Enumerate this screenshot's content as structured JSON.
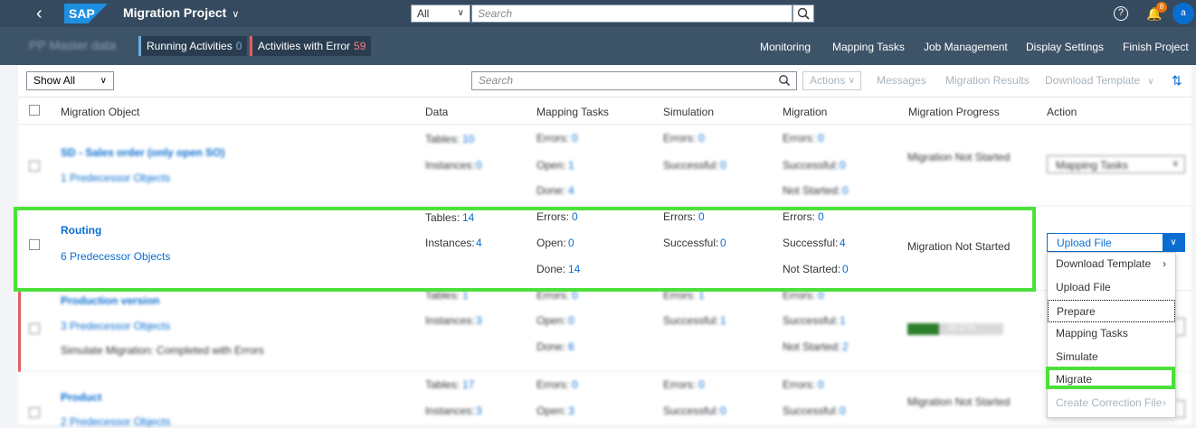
{
  "shell": {
    "logo": "SAP",
    "app_title": "Migration Project",
    "scope": "All",
    "search_placeholder": "Search",
    "notification_count": "8",
    "avatar_initial": "a"
  },
  "subheader": {
    "title": "PP Master data",
    "running_label": "Running Activities",
    "running_count": "0",
    "error_label": "Activities with Error",
    "error_count": "59",
    "nav": [
      "Monitoring",
      "Mapping Tasks",
      "Job Management",
      "Display Settings",
      "Finish Project"
    ]
  },
  "toolbar": {
    "filter": "Show All",
    "search_placeholder": "Search",
    "actions": "Actions",
    "messages": "Messages",
    "results": "Migration Results",
    "download": "Download Template"
  },
  "columns": [
    "Migration Object",
    "Data",
    "Mapping Tasks",
    "Simulation",
    "Migration",
    "Migration Progress",
    "Action"
  ],
  "rows": [
    {
      "name": "SD - Sales order (only open SO)",
      "predecessors": "1 Predecessor Objects",
      "note": "",
      "tables_label": "Tables:",
      "tables": "10",
      "instances_label": "Instances:",
      "instances": "0",
      "map_errors_label": "Errors:",
      "map_errors": "0",
      "open_label": "Open:",
      "open": "1",
      "done_label": "Done:",
      "done": "4",
      "sim_errors_label": "Errors:",
      "sim_errors": "0",
      "sim_success_label": "Successful:",
      "sim_success": "0",
      "mig_errors_label": "Errors:",
      "mig_errors": "0",
      "mig_success_label": "Successful:",
      "mig_success": "0",
      "not_started_label": "Not Started:",
      "not_started": "0",
      "progress": "Migration Not Started",
      "action": "Mapping Tasks"
    },
    {
      "name": "Routing",
      "predecessors": "6 Predecessor Objects",
      "note": "",
      "tables_label": "Tables:",
      "tables": "14",
      "instances_label": "Instances:",
      "instances": "4",
      "map_errors_label": "Errors:",
      "map_errors": "0",
      "open_label": "Open:",
      "open": "0",
      "done_label": "Done:",
      "done": "14",
      "sim_errors_label": "Errors:",
      "sim_errors": "0",
      "sim_success_label": "Successful:",
      "sim_success": "0",
      "mig_errors_label": "Errors:",
      "mig_errors": "0",
      "mig_success_label": "Successful:",
      "mig_success": "4",
      "not_started_label": "Not Started:",
      "not_started": "0",
      "progress": "Migration Not Started",
      "action": "Upload File"
    },
    {
      "name": "Production version",
      "predecessors": "3 Predecessor Objects",
      "note": "Simulate Migration: Completed with Errors",
      "tables_label": "Tables:",
      "tables": "1",
      "instances_label": "Instances:",
      "instances": "3",
      "map_errors_label": "Errors:",
      "map_errors": "0",
      "open_label": "Open:",
      "open": "0",
      "done_label": "Done:",
      "done": "6",
      "sim_errors_label": "Errors:",
      "sim_errors": "1",
      "sim_success_label": "Successful:",
      "sim_success": "1",
      "mig_errors_label": "Errors:",
      "mig_errors": "0",
      "mig_success_label": "Successful:",
      "mig_success": "1",
      "not_started_label": "Not Started:",
      "not_started": "2",
      "progress": "40.67%",
      "progress_fraction": 0.33,
      "action": ""
    },
    {
      "name": "Product",
      "predecessors": "2 Predecessor Objects",
      "note": "",
      "tables_label": "Tables:",
      "tables": "17",
      "instances_label": "Instances:",
      "instances": "3",
      "map_errors_label": "Errors:",
      "map_errors": "0",
      "open_label": "Open:",
      "open": "3",
      "done_label": "",
      "sim_errors_label": "Errors:",
      "sim_errors": "0",
      "sim_success_label": "Successful:",
      "sim_success": "0",
      "mig_errors_label": "Errors:",
      "mig_errors": "0",
      "mig_success_label": "Successful:",
      "mig_success": "0",
      "not_started_label": "",
      "progress": "Migration Not Started",
      "action": ""
    }
  ],
  "menu": [
    {
      "label": "Download Template",
      "submenu": true,
      "disabled": false
    },
    {
      "label": "Upload File",
      "submenu": false,
      "disabled": false
    },
    {
      "label": "Prepare",
      "submenu": false,
      "disabled": false
    },
    {
      "label": "Mapping Tasks",
      "submenu": false,
      "disabled": false
    },
    {
      "label": "Simulate",
      "submenu": false,
      "disabled": false
    },
    {
      "label": "Migrate",
      "submenu": false,
      "disabled": false
    },
    {
      "label": "Create Correction File",
      "submenu": true,
      "disabled": true
    }
  ],
  "colors": {
    "shell": "#354a5f",
    "accent": "#0a6ed1",
    "highlight": "#4ce03a",
    "error": "#e06060"
  }
}
